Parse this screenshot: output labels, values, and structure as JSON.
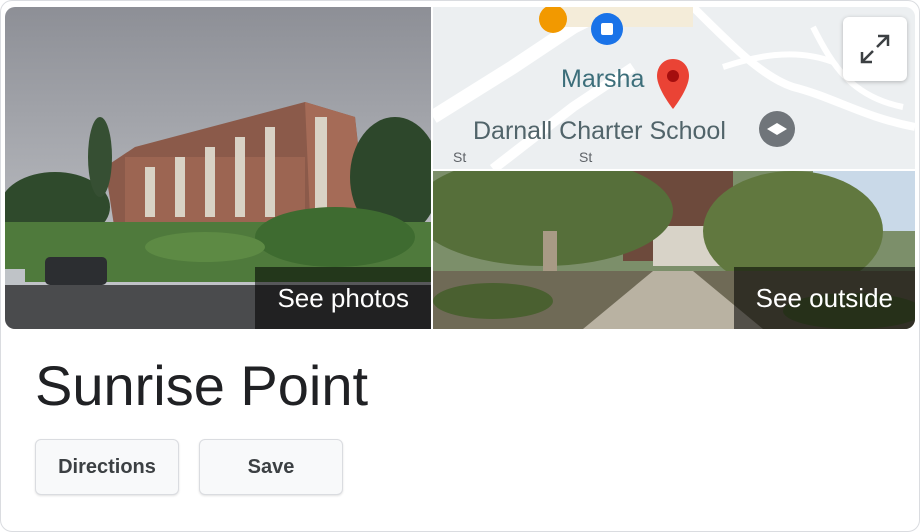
{
  "place": {
    "name": "Sunrise Point"
  },
  "photos": {
    "main_label": "See photos",
    "outside_label": "See outside"
  },
  "map": {
    "label_nearby": "Marsha",
    "label_school": "Darnall Charter School",
    "street_label_1": "St",
    "street_label_2": "St",
    "expand_icon": "expand-icon",
    "pin_color": "#ea4335"
  },
  "actions": {
    "directions_label": "Directions",
    "save_label": "Save"
  }
}
